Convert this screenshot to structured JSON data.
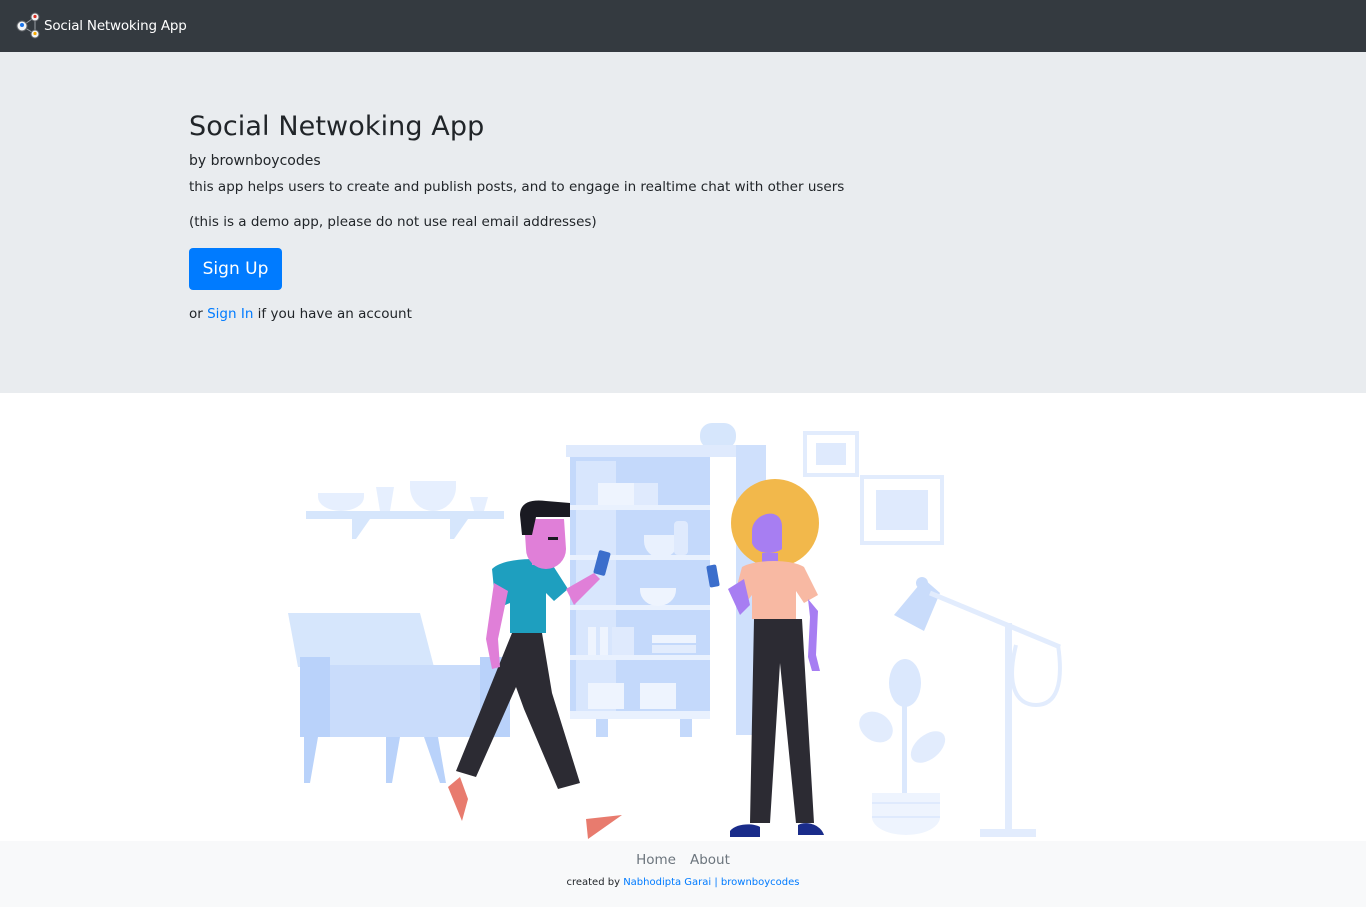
{
  "navbar": {
    "brand_text": "Social Netwoking App",
    "brand_icon": "network-people-icon"
  },
  "hero": {
    "title": "Social Netwoking App",
    "byline": "by brownboycodes",
    "description": "this app helps users to create and publish posts, and to engage in realtime chat with other users",
    "notice": "(this is a demo app, please do not use real email addresses)",
    "signup_label": "Sign Up",
    "signin_prefix": "or ",
    "signin_label": "Sign In",
    "signin_suffix": " if you have an account"
  },
  "illustration": {
    "icon": "people-with-phones-illustration"
  },
  "footer": {
    "links": [
      "Home",
      "About"
    ],
    "credit_prefix": "created by ",
    "credit_link": "Nabhodipta Garai | brownboycodes"
  },
  "colors": {
    "navbar": "#343a40",
    "jumbotron": "#e9ecef",
    "primary": "#007bff",
    "footer": "#f8f9fa"
  }
}
